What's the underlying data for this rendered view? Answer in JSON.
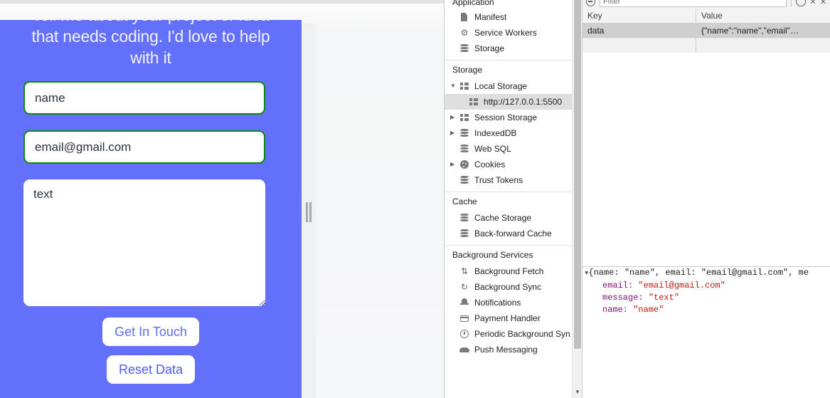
{
  "page": {
    "form": {
      "heading_clipped_line": "Tell me about your project or idea",
      "heading_line2": "that needs coding. I'd love to help",
      "heading_line3": "with it",
      "name_value": "name",
      "name_placeholder": "name",
      "email_value": "email@gmail.com",
      "email_placeholder": "email@gmail.com",
      "message_value": "text",
      "message_placeholder": "text",
      "submit_label": "Get In Touch",
      "reset_label": "Reset Data",
      "accent_background": "#6270fa",
      "input_border_color": "#0a8a12",
      "button_text_color": "#5b6cf5"
    }
  },
  "devtools": {
    "sidebar": {
      "groups": [
        {
          "title": "Application",
          "items": [
            {
              "label": "Manifest",
              "icon": "document-icon",
              "arrow": "",
              "indent": false,
              "selected": false
            },
            {
              "label": "Service Workers",
              "icon": "gear-icon",
              "arrow": "",
              "indent": false,
              "selected": false
            },
            {
              "label": "Storage",
              "icon": "database-icon",
              "arrow": "",
              "indent": false,
              "selected": false
            }
          ]
        },
        {
          "title": "Storage",
          "items": [
            {
              "label": "Local Storage",
              "icon": "grid-icon",
              "arrow": "▼",
              "indent": false,
              "selected": false
            },
            {
              "label": "http://127.0.0.1:5500",
              "icon": "grid-icon",
              "arrow": "",
              "indent": true,
              "selected": true
            },
            {
              "label": "Session Storage",
              "icon": "grid-icon",
              "arrow": "▶",
              "indent": false,
              "selected": false
            },
            {
              "label": "IndexedDB",
              "icon": "database-icon",
              "arrow": "▶",
              "indent": false,
              "selected": false
            },
            {
              "label": "Web SQL",
              "icon": "database-icon",
              "arrow": "",
              "indent": false,
              "selected": false
            },
            {
              "label": "Cookies",
              "icon": "cookie-icon",
              "arrow": "▶",
              "indent": false,
              "selected": false
            },
            {
              "label": "Trust Tokens",
              "icon": "database-icon",
              "arrow": "",
              "indent": false,
              "selected": false
            }
          ]
        },
        {
          "title": "Cache",
          "items": [
            {
              "label": "Cache Storage",
              "icon": "database-icon",
              "arrow": "",
              "indent": false,
              "selected": false
            },
            {
              "label": "Back-forward Cache",
              "icon": "database-icon",
              "arrow": "",
              "indent": false,
              "selected": false
            }
          ]
        },
        {
          "title": "Background Services",
          "items": [
            {
              "label": "Background Fetch",
              "icon": "up-down-arrows-icon",
              "arrow": "",
              "indent": false,
              "selected": false
            },
            {
              "label": "Background Sync",
              "icon": "refresh-icon",
              "arrow": "",
              "indent": false,
              "selected": false
            },
            {
              "label": "Notifications",
              "icon": "bell-icon",
              "arrow": "",
              "indent": false,
              "selected": false
            },
            {
              "label": "Payment Handler",
              "icon": "credit-card-icon",
              "arrow": "",
              "indent": false,
              "selected": false
            },
            {
              "label": "Periodic Background Syn",
              "icon": "clock-icon",
              "arrow": "",
              "indent": false,
              "selected": false
            },
            {
              "label": "Push Messaging",
              "icon": "cloud-icon",
              "arrow": "",
              "indent": false,
              "selected": false
            }
          ]
        }
      ],
      "scroll_down_arrow": "▼"
    },
    "toolbar": {
      "filter_placeholder": "Filter",
      "filter_value": "",
      "clear_icon": "clear-circle-icon",
      "refresh_icon": "refresh-circle-icon",
      "xx_label": "✕ ✕"
    },
    "table": {
      "columns": [
        "Key",
        "Value"
      ],
      "rows": [
        {
          "key": "data",
          "value": "{\"name\":\"name\",\"email\"…",
          "selected": true
        }
      ]
    },
    "preview": {
      "toggle_icon": "▼",
      "summary": "{name: \"name\", email: \"email@gmail.com\", me",
      "entries": [
        {
          "key": "email:",
          "value": "\"email@gmail.com\""
        },
        {
          "key": "message:",
          "value": "\"text\""
        },
        {
          "key": "name:",
          "value": "\"name\""
        }
      ],
      "key_color": "#881280",
      "string_color": "#c41a16"
    }
  }
}
